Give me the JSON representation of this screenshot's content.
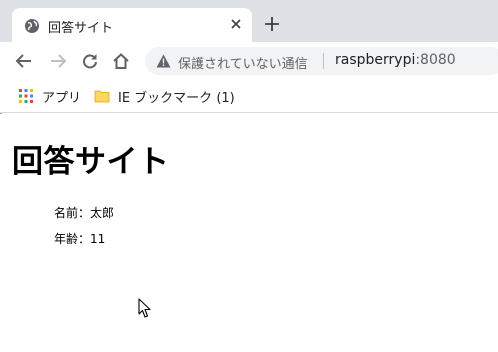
{
  "tab": {
    "title": "回答サイト",
    "favicon_icon": "globe-icon",
    "close_icon": "close-icon"
  },
  "new_tab_icon": "plus-icon",
  "toolbar": {
    "back_icon": "arrow-left-icon",
    "forward_icon": "arrow-right-icon",
    "reload_icon": "reload-icon",
    "home_icon": "home-icon"
  },
  "omnibox": {
    "security_text": "保護されていない通信",
    "host": "raspberrypi",
    "port": ":8080",
    "warning_icon": "warning-triangle-icon"
  },
  "bookmarks": [
    {
      "label": "アプリ",
      "icon": "apps-grid-icon"
    },
    {
      "label": "IE ブックマーク (1)",
      "icon": "folder-icon"
    }
  ],
  "page": {
    "heading": "回答サイト",
    "name_line": "名前：太郎",
    "age_line": "年齢：11"
  },
  "colors": {
    "tabstrip_bg": "#dee1e6",
    "omnibox_bg": "#f1f3f4",
    "icon_gray": "#5f6368",
    "folder_yellow": "#fdd663"
  }
}
